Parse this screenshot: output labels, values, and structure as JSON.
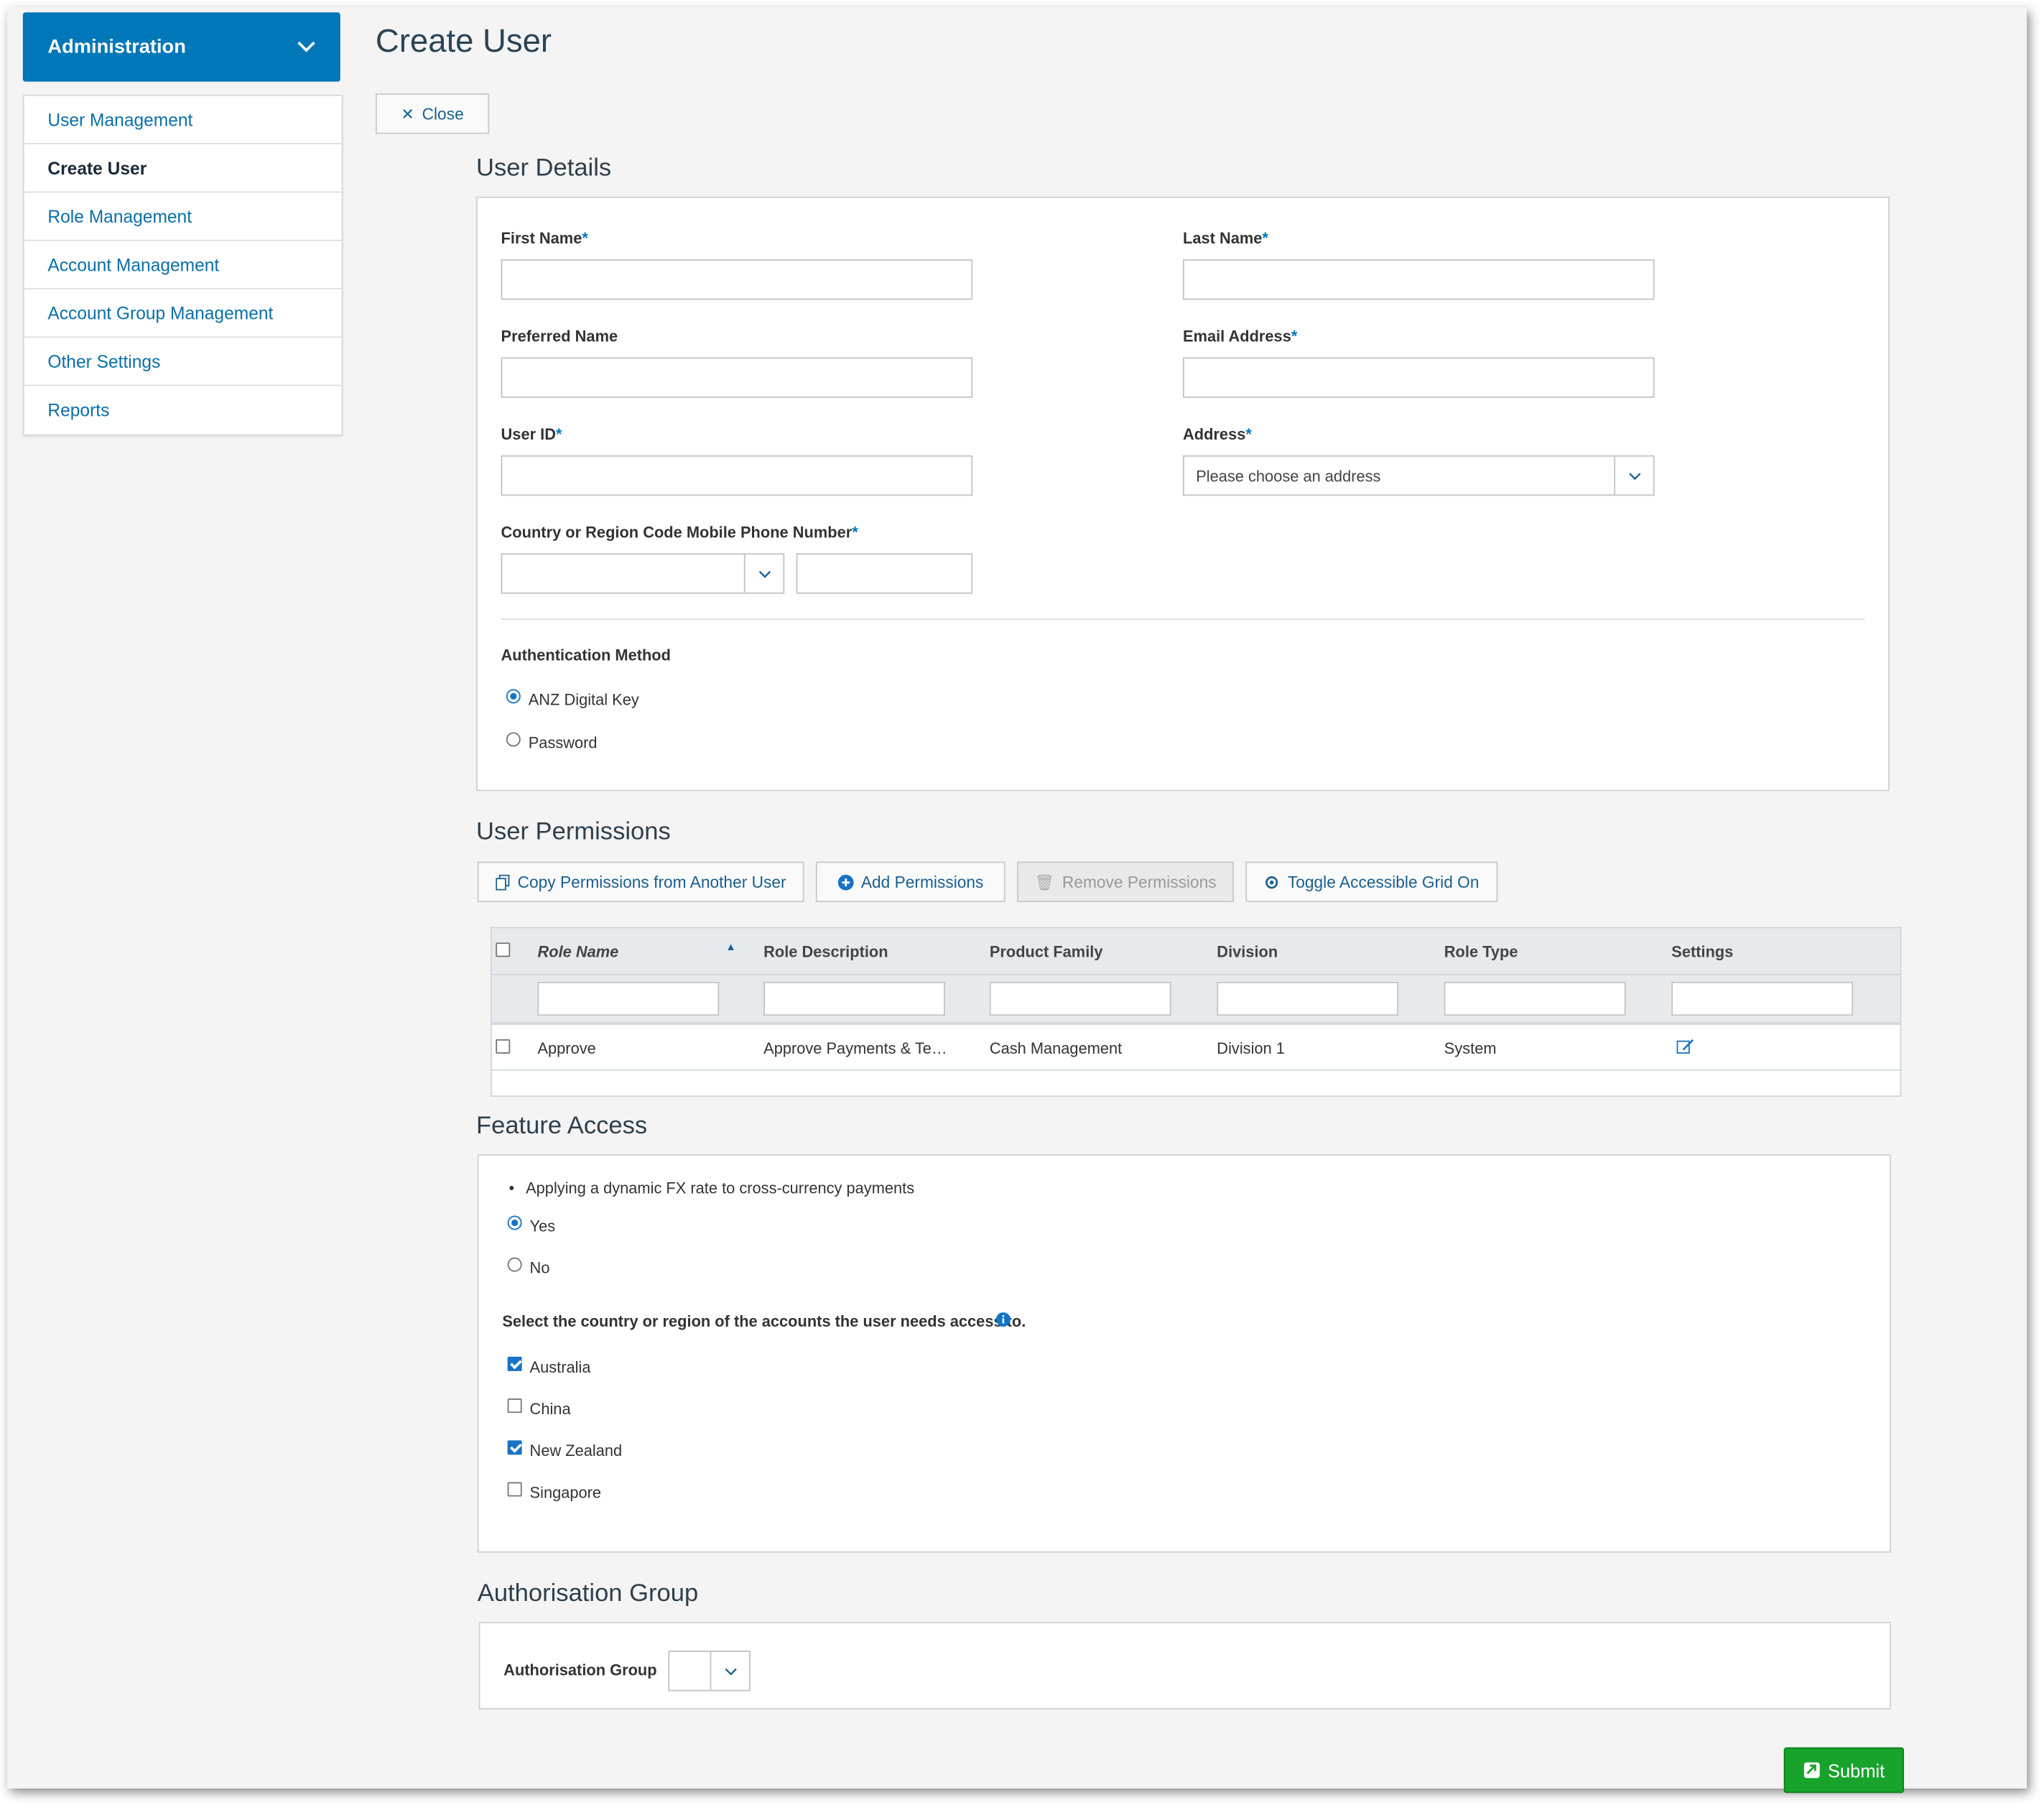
{
  "sidebar": {
    "header": "Administration",
    "items": [
      {
        "label": "User Management"
      },
      {
        "label": "Create User"
      },
      {
        "label": "Role Management"
      },
      {
        "label": "Account Management"
      },
      {
        "label": "Account Group Management"
      },
      {
        "label": "Other Settings"
      },
      {
        "label": "Reports"
      }
    ]
  },
  "page": {
    "title": "Create User",
    "close_label": "Close"
  },
  "user_details": {
    "title": "User Details",
    "first_name_label": "First Name",
    "last_name_label": "Last Name",
    "preferred_name_label": "Preferred Name",
    "email_label": "Email Address",
    "user_id_label": "User ID",
    "address_label": "Address",
    "address_placeholder": "Please choose an address",
    "phone_label": "Country or Region Code Mobile Phone Number",
    "required_mark": "*",
    "auth_label": "Authentication Method",
    "auth_options": [
      {
        "label": "ANZ Digital Key",
        "selected": true
      },
      {
        "label": "Password",
        "selected": false
      }
    ]
  },
  "permissions": {
    "title": "User Permissions",
    "buttons": {
      "copy": "Copy Permissions from Another User",
      "add": "Add Permissions",
      "remove": "Remove Permissions",
      "toggle": "Toggle Accessible Grid On"
    },
    "columns": [
      "Role Name",
      "Role Description",
      "Product Family",
      "Division",
      "Role Type",
      "Settings"
    ],
    "rows": [
      {
        "role_name": "Approve",
        "role_description": "Approve Payments & Te…",
        "product_family": "Cash Management",
        "division": "Division 1",
        "role_type": "System"
      }
    ]
  },
  "feature_access": {
    "title": "Feature Access",
    "bullet": "Applying a dynamic FX rate to cross-currency payments",
    "fx_options": [
      {
        "label": "Yes",
        "selected": true
      },
      {
        "label": "No",
        "selected": false
      }
    ],
    "country_prompt": "Select the country or region of the accounts the user needs access to.",
    "countries": [
      {
        "label": "Australia",
        "checked": true
      },
      {
        "label": "China",
        "checked": false
      },
      {
        "label": "New Zealand",
        "checked": true
      },
      {
        "label": "Singapore",
        "checked": false
      }
    ]
  },
  "auth_group": {
    "title": "Authorisation Group",
    "label": "Authorisation Group"
  },
  "submit_label": "Submit",
  "colors": {
    "primary": "#0077b8",
    "link": "#0a6fa9",
    "submit": "#17a32c"
  }
}
